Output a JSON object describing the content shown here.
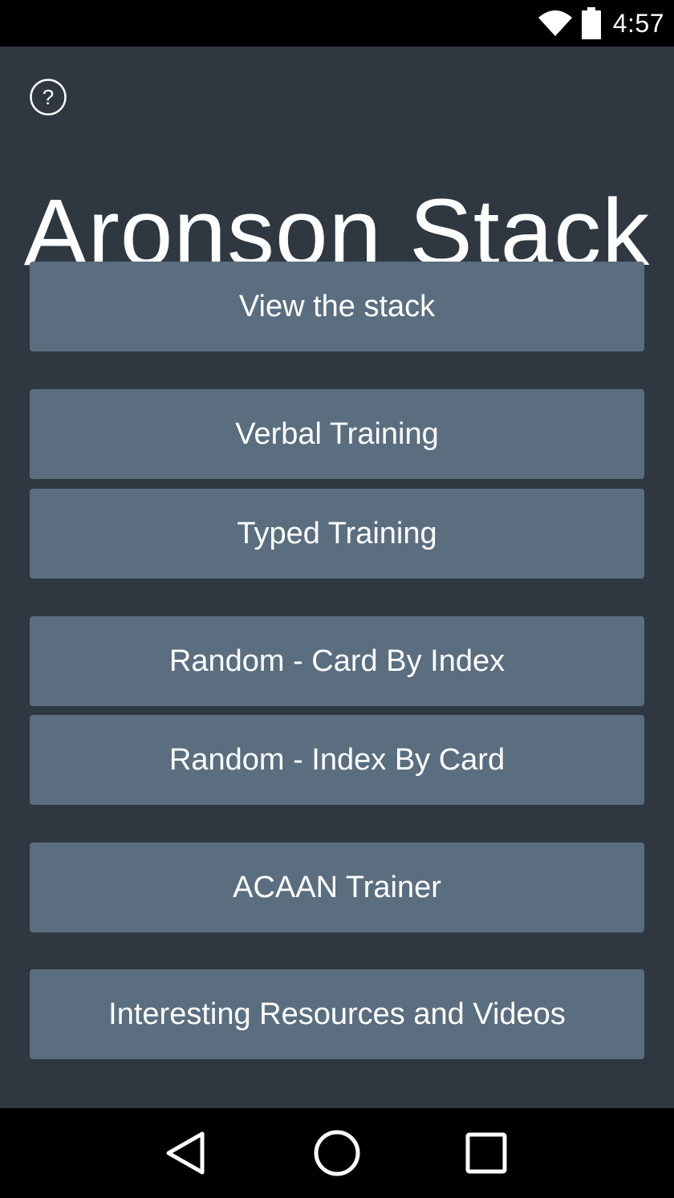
{
  "status_bar": {
    "time": "4:57",
    "icons": [
      "wifi-icon",
      "battery-icon"
    ]
  },
  "app": {
    "help_icon": "help-icon",
    "help_glyph": "?",
    "title": "Aronson Stack",
    "buttons": [
      {
        "label": "View the stack"
      },
      {
        "label": "Verbal Training"
      },
      {
        "label": "Typed Training"
      },
      {
        "label": "Random - Card By Index"
      },
      {
        "label": "Random - Index By Card"
      },
      {
        "label": "ACAAN Trainer"
      },
      {
        "label": "Interesting Resources and Videos"
      }
    ]
  },
  "nav_bar": {
    "icons": [
      "back-icon",
      "home-icon",
      "recents-icon"
    ]
  },
  "colors": {
    "background": "#2f3841",
    "button": "#5a6e80",
    "text": "#ffffff",
    "system_bars": "#000000"
  }
}
